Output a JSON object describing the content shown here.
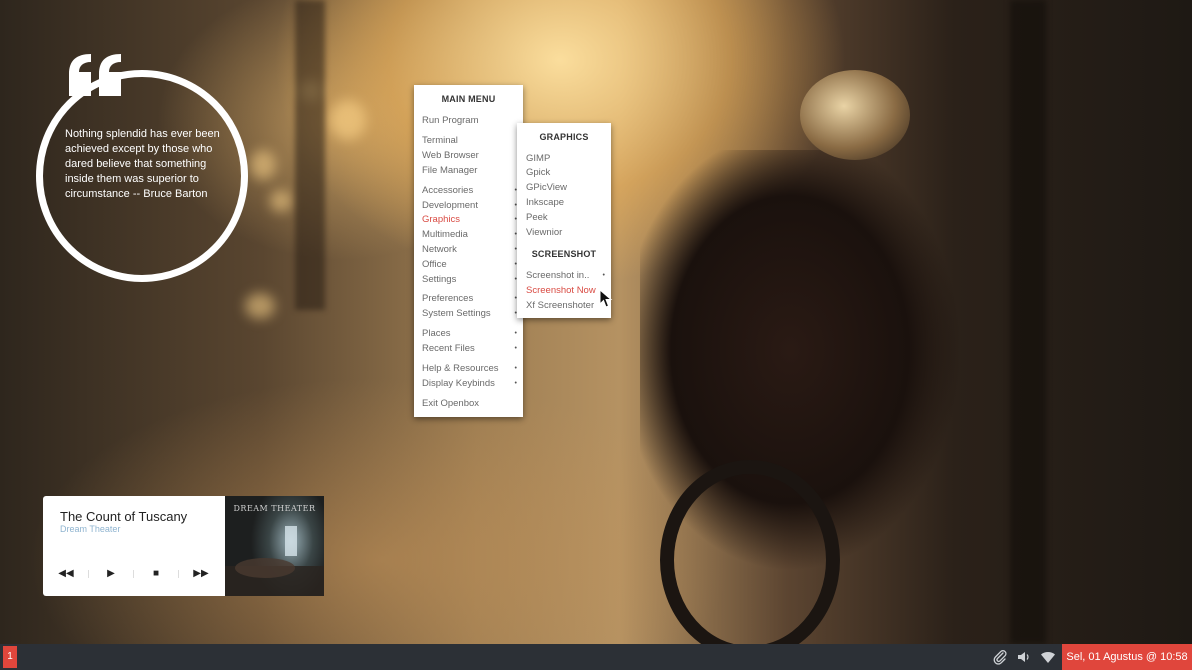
{
  "quote": {
    "text": "Nothing splendid has ever been achieved except by those who dared believe that something inside them was superior to circumstance -- Bruce Barton"
  },
  "main_menu": {
    "title": "MAIN MENU",
    "items": [
      {
        "label": "Run Program",
        "submenu": false
      },
      {
        "label": "Terminal",
        "submenu": false
      },
      {
        "label": "Web Browser",
        "submenu": false
      },
      {
        "label": "File Manager",
        "submenu": false
      },
      {
        "label": "Accessories",
        "submenu": true
      },
      {
        "label": "Development",
        "submenu": true
      },
      {
        "label": "Graphics",
        "submenu": true,
        "active": true
      },
      {
        "label": "Multimedia",
        "submenu": true
      },
      {
        "label": "Network",
        "submenu": true
      },
      {
        "label": "Office",
        "submenu": true
      },
      {
        "label": "Settings",
        "submenu": true
      },
      {
        "label": "Preferences",
        "submenu": true
      },
      {
        "label": "System Settings",
        "submenu": true
      },
      {
        "label": "Places",
        "submenu": true
      },
      {
        "label": "Recent Files",
        "submenu": true
      },
      {
        "label": "Help & Resources",
        "submenu": true
      },
      {
        "label": "Display Keybinds",
        "submenu": true
      },
      {
        "label": "Exit Openbox",
        "submenu": false
      }
    ]
  },
  "graphics_menu": {
    "title": "GRAPHICS",
    "items": [
      {
        "label": "GIMP"
      },
      {
        "label": "Gpick"
      },
      {
        "label": "GPicView"
      },
      {
        "label": "Inkscape"
      },
      {
        "label": "Peek"
      },
      {
        "label": "Viewnior"
      }
    ],
    "screenshot_title": "SCREENSHOT",
    "screenshot_items": [
      {
        "label": "Screenshot in..",
        "submenu": true
      },
      {
        "label": "Screenshot Now",
        "active": true
      },
      {
        "label": "Xf Screenshoter"
      }
    ]
  },
  "player": {
    "title": "The Count of Tuscany",
    "artist": "Dream Theater",
    "album_band": "DREAM THEATER",
    "controls": {
      "previous": "◀◀",
      "play": "▶",
      "stop": "■",
      "next": "▶▶"
    }
  },
  "taskbar": {
    "workspace": "1",
    "clock": "Sel, 01 Agustus @ 10:58",
    "icons": [
      "paperclip-icon",
      "volume-icon",
      "wifi-icon"
    ]
  },
  "colors": {
    "accent": "#e0463c",
    "menu_active": "#d94b43",
    "taskbar": "#2c3036",
    "artist_text": "#8fb4d0"
  }
}
